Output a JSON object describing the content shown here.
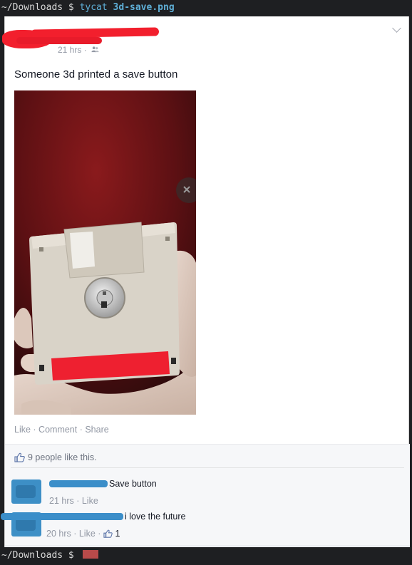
{
  "terminal": {
    "top_prompt": "~/Downloads $ ",
    "top_command": "tycat",
    "top_file": "3d-save.png",
    "bottom_prompt": "~/Downloads $ "
  },
  "post": {
    "timestamp": "21 hrs",
    "separator": " · ",
    "privacy_icon": "friends-icon",
    "text": "Someone 3d printed a save button",
    "photo_subject": "3D printed floppy disk held in hand",
    "actions": {
      "like": "Like",
      "comment": "Comment",
      "share": "Share",
      "sep": " · "
    },
    "likes_summary": "9 people like this.",
    "comments": [
      {
        "text": "Save button",
        "time": "21 hrs",
        "like_label": "Like",
        "like_count": ""
      },
      {
        "text": "i love the future",
        "time": "20 hrs",
        "like_label": "Like",
        "like_count": "1"
      }
    ]
  },
  "colors": {
    "redaction_red": "#f21f2d",
    "redaction_blue": "#3b8ec9",
    "meta_gray": "#9197a3",
    "text_dark": "#141823",
    "terminal_bg": "#1e1f22",
    "terminal_accent": "#5fafd7"
  }
}
